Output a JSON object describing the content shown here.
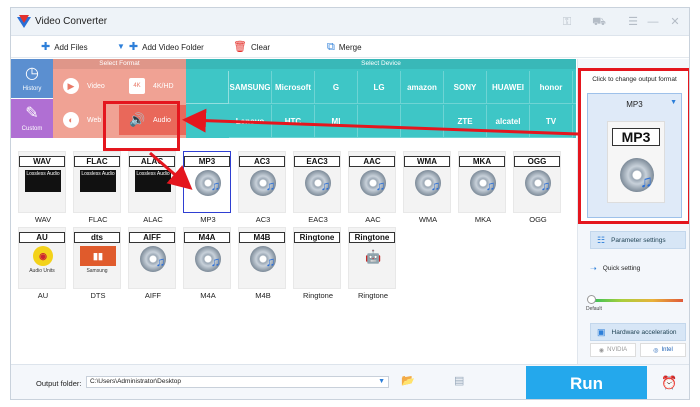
{
  "app": {
    "title": "Video Converter"
  },
  "window_controls": {
    "minimize": "—",
    "close": "✕"
  },
  "toolbar": {
    "add_files": "Add Files",
    "add_folder": "Add Video Folder",
    "clear": "Clear",
    "merge": "Merge"
  },
  "side": {
    "history": "History",
    "custom": "Custom"
  },
  "select_format": {
    "header": "Select Format",
    "items": [
      {
        "label": "Video",
        "icon": "play-icon"
      },
      {
        "label": "4K/HD",
        "icon": "4k-icon"
      },
      {
        "label": "Web",
        "icon": "web-icon"
      },
      {
        "label": "Audio",
        "icon": "speaker-icon"
      }
    ]
  },
  "select_device": {
    "header": "Select Device",
    "row1": [
      "",
      "SAMSUNG",
      "Microsoft",
      "G",
      "LG",
      "amazon",
      "SONY",
      "HUAWEI",
      "honor",
      "ASUS"
    ],
    "row2": [
      "Lenovo",
      "HTC",
      "MI",
      "",
      "",
      "ZTE",
      "alcatel",
      "TV"
    ]
  },
  "formats": [
    {
      "label": "WAV",
      "name": "WAV",
      "style": "lossless",
      "sub": "Lossless Audio"
    },
    {
      "label": "FLAC",
      "name": "FLAC",
      "style": "lossless",
      "sub": "Lossless Audio"
    },
    {
      "label": "ALAC",
      "name": "ALAC",
      "style": "lossless",
      "sub": "Lossless Audio"
    },
    {
      "label": "MP3",
      "name": "MP3",
      "style": "disc",
      "selected": true
    },
    {
      "label": "AC3",
      "name": "AC3",
      "style": "disc"
    },
    {
      "label": "EAC3",
      "name": "EAC3",
      "style": "disc"
    },
    {
      "label": "AAC",
      "name": "AAC",
      "style": "disc"
    },
    {
      "label": "WMA",
      "name": "WMA",
      "style": "disc"
    },
    {
      "label": "MKA",
      "name": "MKA",
      "style": "disc"
    },
    {
      "label": "OGG",
      "name": "OGG",
      "style": "disc"
    },
    {
      "label": "AU",
      "name": "AU",
      "style": "au",
      "sub": "Audio Units"
    },
    {
      "label": "dts",
      "name": "DTS",
      "style": "dts",
      "sub": "Samsung"
    },
    {
      "label": "AIFF",
      "name": "AIFF",
      "style": "disc"
    },
    {
      "label": "M4A",
      "name": "M4A",
      "style": "disc"
    },
    {
      "label": "M4B",
      "name": "M4B",
      "style": "disc"
    },
    {
      "label": "Ringtone",
      "name": "Ringtone",
      "style": "apple"
    },
    {
      "label": "Ringtone",
      "name": "Ringtone",
      "style": "android"
    }
  ],
  "output": {
    "hint": "Click to change output format",
    "value": "MP3",
    "icon_label": "MP3"
  },
  "right": {
    "param": "Parameter settings",
    "quick": "Quick setting",
    "default": "Default",
    "hw": "Hardware acceleration",
    "nvidia": "NVIDIA",
    "intel": "Intel"
  },
  "bottom": {
    "output_label": "Output folder:",
    "output_path": "C:\\Users\\Administrator\\Desktop",
    "run": "Run"
  }
}
